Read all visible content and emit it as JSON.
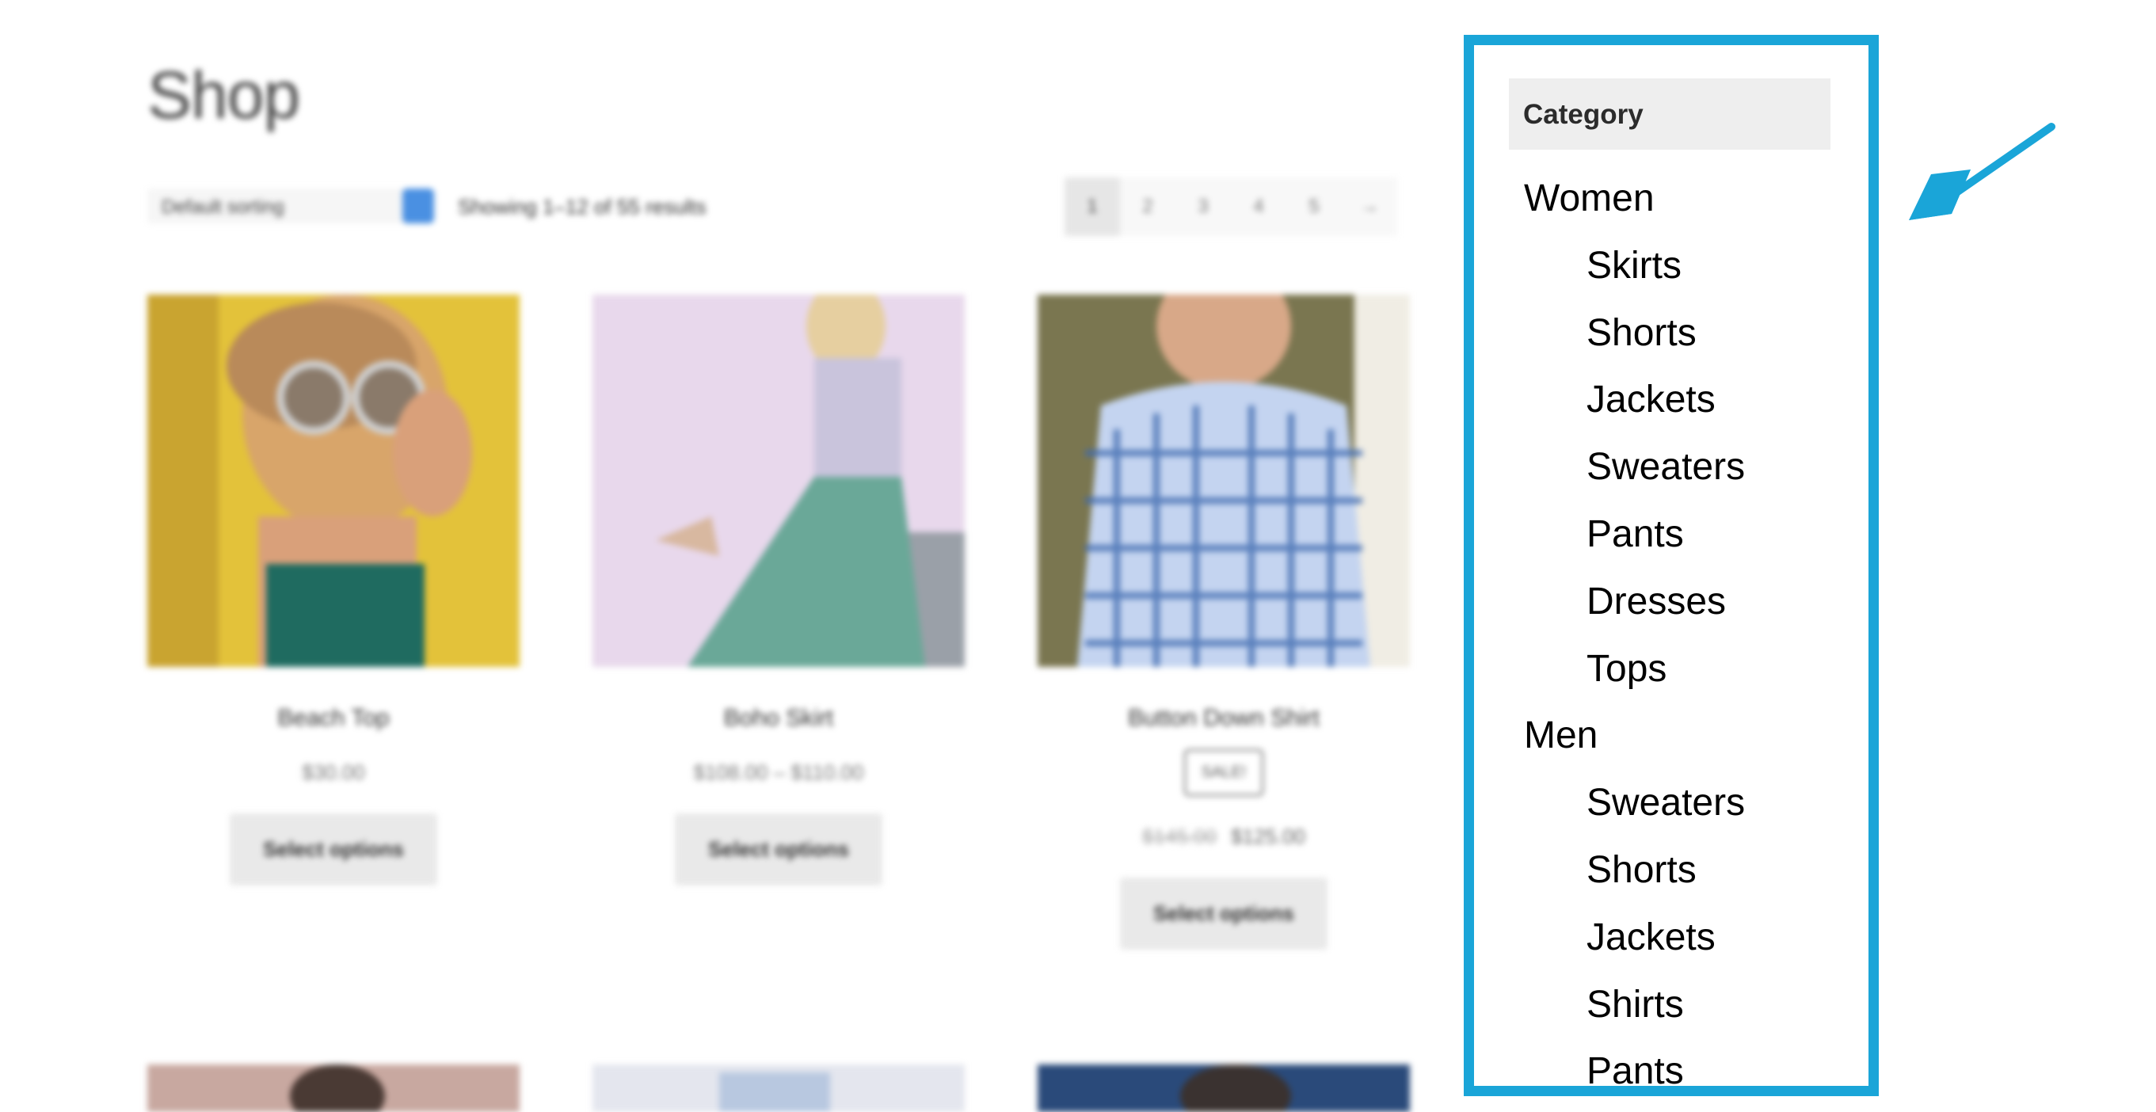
{
  "shop": {
    "title": "Shop",
    "sorting": "Default sorting",
    "result_count": "Showing 1–12 of 55 results",
    "pagination": [
      "1",
      "2",
      "3",
      "4",
      "5",
      "→"
    ]
  },
  "products": [
    {
      "title": "Beach Top",
      "price": "$30.00",
      "button": "Select options"
    },
    {
      "title": "Boho Skirt",
      "price": "$108.00 – $110.00",
      "button": "Select options"
    },
    {
      "title": "Button Down Shirt",
      "sale": "SALE!",
      "old_price": "$145.00",
      "new_price": "$125.00",
      "button": "Select options"
    }
  ],
  "sidebar": {
    "header": "Category",
    "items": [
      {
        "label": "Women",
        "level": "parent"
      },
      {
        "label": "Skirts",
        "level": "child"
      },
      {
        "label": "Shorts",
        "level": "child"
      },
      {
        "label": "Jackets",
        "level": "child"
      },
      {
        "label": "Sweaters",
        "level": "child"
      },
      {
        "label": "Pants",
        "level": "child"
      },
      {
        "label": "Dresses",
        "level": "child"
      },
      {
        "label": "Tops",
        "level": "child"
      },
      {
        "label": "Men",
        "level": "parent"
      },
      {
        "label": "Sweaters",
        "level": "child"
      },
      {
        "label": "Shorts",
        "level": "child"
      },
      {
        "label": "Jackets",
        "level": "child"
      },
      {
        "label": "Shirts",
        "level": "child"
      },
      {
        "label": "Pants",
        "level": "child"
      }
    ]
  },
  "colors": {
    "highlight": "#1aa5d8",
    "header_bg": "#eeeeee",
    "button_bg": "#e9e9e9",
    "sort_accent": "#4a90e2"
  },
  "icons": [
    "arrow-pointer-icon",
    "sort-arrow-icon"
  ]
}
